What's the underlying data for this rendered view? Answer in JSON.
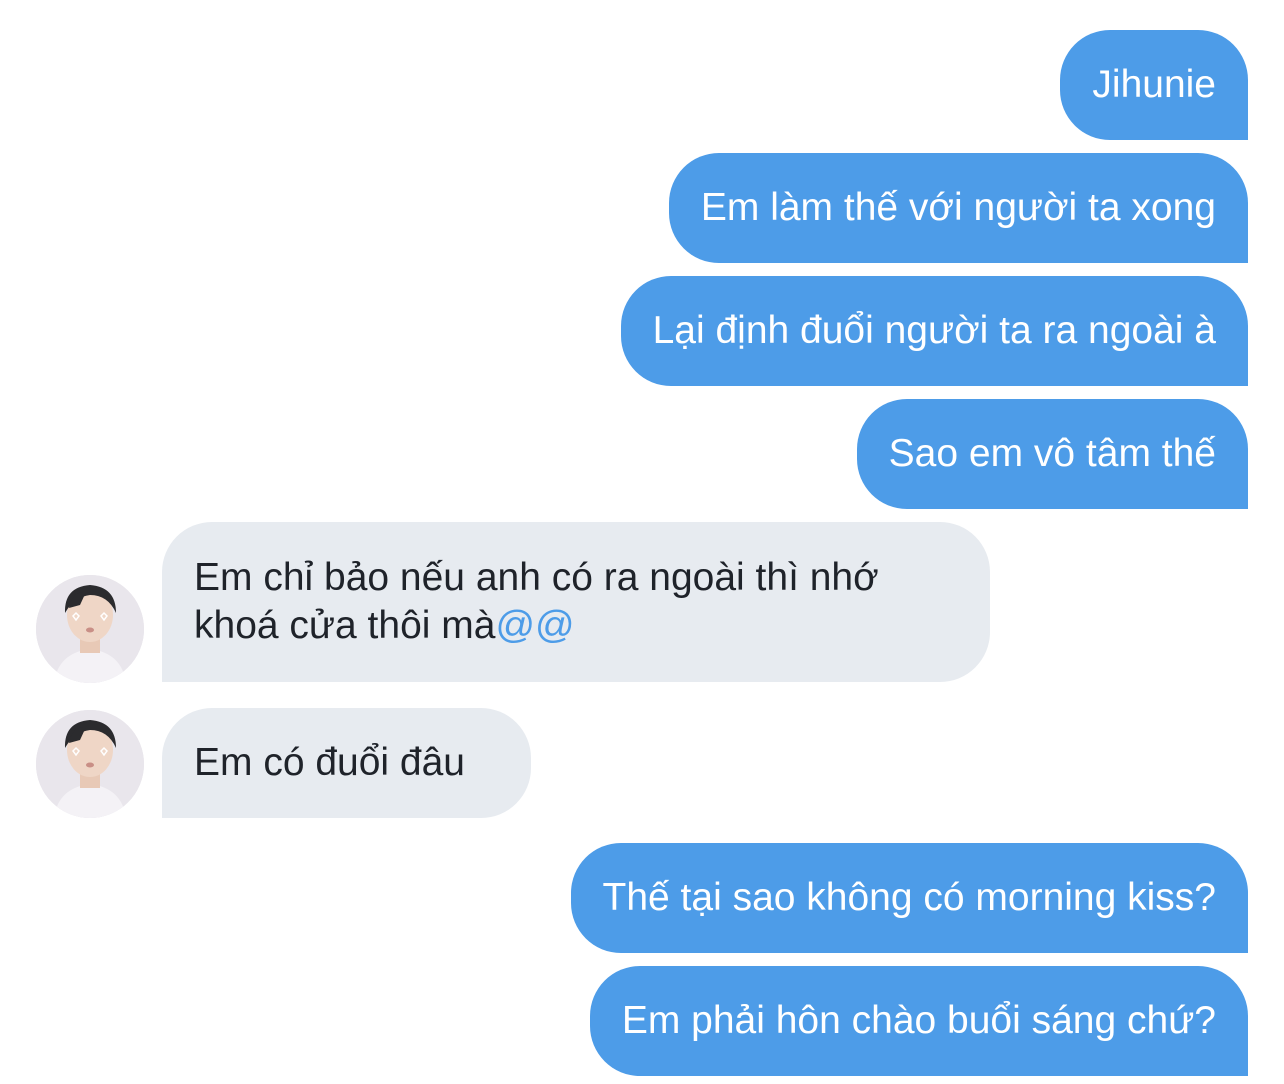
{
  "conversation": {
    "messages": [
      {
        "sender": "me",
        "text": "Jihunie"
      },
      {
        "sender": "me",
        "text": "Em làm thế với người ta xong"
      },
      {
        "sender": "me",
        "text": "Lại định đuổi người ta ra ngoài à"
      },
      {
        "sender": "me",
        "text": "Sao em vô tâm thế"
      },
      {
        "sender": "other",
        "text": "Em chỉ bảo nếu anh có ra ngoài thì nhớ",
        "text_line2": "khoá cửa thôi mà",
        "mention": "@@"
      },
      {
        "sender": "other",
        "text": "Em có đuổi đâu"
      },
      {
        "sender": "me",
        "text": "Thế tại sao không có morning kiss?"
      },
      {
        "sender": "me",
        "text": "Em phải hôn chào buổi sáng chứ?"
      }
    ]
  },
  "colors": {
    "outgoing_bubble": "#4d9ce8",
    "incoming_bubble": "#e7ebf0",
    "incoming_text": "#1f232a",
    "mention": "#4d9ce8"
  },
  "icons": {
    "avatar": "profile-photo"
  }
}
